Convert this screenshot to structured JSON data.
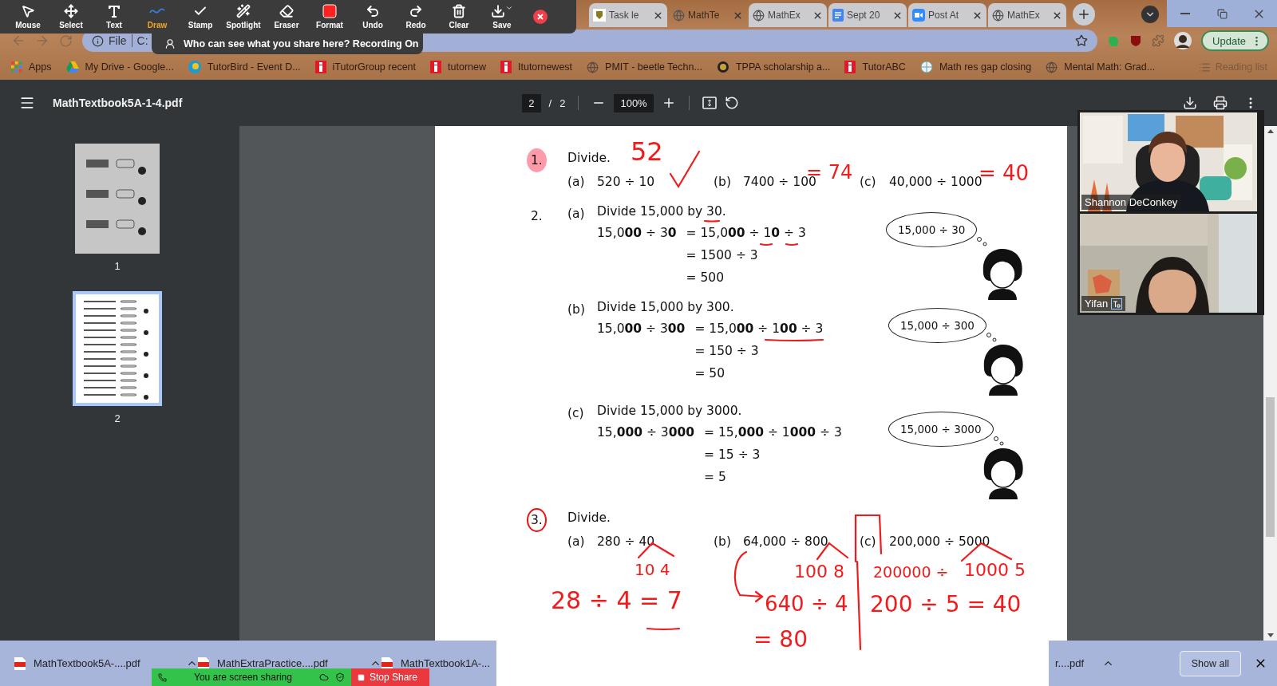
{
  "zoom_toolbar": {
    "tools": [
      {
        "label": "Mouse",
        "selected": false
      },
      {
        "label": "Select",
        "selected": false
      },
      {
        "label": "Text",
        "selected": false
      },
      {
        "label": "Draw",
        "selected": true
      },
      {
        "label": "Stamp",
        "selected": false
      },
      {
        "label": "Spotlight",
        "selected": false
      },
      {
        "label": "Eraser",
        "selected": false
      },
      {
        "label": "Format",
        "selected": false
      },
      {
        "label": "Undo",
        "selected": false
      },
      {
        "label": "Redo",
        "selected": false
      },
      {
        "label": "Clear",
        "selected": false
      },
      {
        "label": "Save",
        "selected": false
      }
    ],
    "banner": "Who can see what you share here? Recording On"
  },
  "tabs": [
    {
      "label": "Task le",
      "selected": false
    },
    {
      "label": "MathTe",
      "selected": true
    },
    {
      "label": "MathEx",
      "selected": false
    },
    {
      "label": "Sept 20",
      "selected": false
    },
    {
      "label": "Post At",
      "selected": false
    },
    {
      "label": "MathEx",
      "selected": false
    }
  ],
  "address_bar": {
    "scheme": "File",
    "url": "C:"
  },
  "update_button": "Update",
  "bookmarks": [
    {
      "label": "Apps"
    },
    {
      "label": "My Drive - Google..."
    },
    {
      "label": "TutorBird - Event D..."
    },
    {
      "label": "iTutorGroup recent"
    },
    {
      "label": "tutornew"
    },
    {
      "label": "Itutornewest"
    },
    {
      "label": "PMIT - beetle Techn..."
    },
    {
      "label": "TPPA scholarship a..."
    },
    {
      "label": "TutorABC"
    },
    {
      "label": "Math res gap closing"
    },
    {
      "label": "Mental Math: Grad..."
    }
  ],
  "reading_list": "Reading list",
  "pdf_toolbar": {
    "title": "MathTextbook5A-1-4.pdf",
    "page": "2",
    "separator": "/",
    "page_count": "2",
    "zoom": "100%"
  },
  "thumbnails": [
    {
      "label": "1",
      "selected": false
    },
    {
      "label": "2",
      "selected": true
    }
  ],
  "document": {
    "problem_1": {
      "number": "1.",
      "highlighted": true,
      "title": "Divide.",
      "parts": [
        {
          "label": "(a)",
          "expr": "520 ÷ 10"
        },
        {
          "label": "(b)",
          "expr": "7400 ÷ 100"
        },
        {
          "label": "(c)",
          "expr": "40,000 ÷ 1000"
        }
      ]
    },
    "problem_2": {
      "number": "2.",
      "parts": [
        {
          "label": "(a)",
          "title": "Divide 15,000 by 30.",
          "lhs": "15,0**00** ÷ 3**0**",
          "steps": [
            "= 15,0**00** ÷ 1**0** ÷ 3",
            "= 1500 ÷ 3",
            "= 500"
          ],
          "bubble": "15,000 ÷ 30"
        },
        {
          "label": "(b)",
          "title": "Divide 15,000 by 300.",
          "lhs": "15,0**00** ÷ 3**00**",
          "steps": [
            "= 15,0**00** ÷ 1**00** ÷ 3",
            "= 150 ÷ 3",
            "= 50"
          ],
          "bubble": "15,000 ÷ 300"
        },
        {
          "label": "(c)",
          "title": "Divide 15,000 by 3000.",
          "lhs": "15,**000** ÷ 3**000**",
          "steps": [
            "= 15,**000** ÷ 1**000** ÷ 3",
            "= 15 ÷ 3",
            "= 5"
          ],
          "bubble": "15,000 ÷ 3000"
        }
      ]
    },
    "problem_3": {
      "number": "3.",
      "circled": true,
      "title": "Divide.",
      "parts": [
        {
          "label": "(a)",
          "expr": "280 ÷ 40"
        },
        {
          "label": "(b)",
          "expr": "64,000 ÷ 800"
        },
        {
          "label": "(c)",
          "expr": "200,000 ÷ 5000"
        }
      ]
    }
  },
  "annotations": [
    {
      "kind": "text",
      "text": "52"
    },
    {
      "kind": "check"
    },
    {
      "kind": "text",
      "text": "= 74"
    },
    {
      "kind": "text",
      "text": "= 40"
    },
    {
      "kind": "underline"
    },
    {
      "kind": "underline"
    },
    {
      "kind": "underline"
    },
    {
      "kind": "underline"
    },
    {
      "kind": "split"
    },
    {
      "kind": "text",
      "text": "10 4"
    },
    {
      "kind": "text",
      "text": "28 ÷ 4 = 7"
    },
    {
      "kind": "underline"
    },
    {
      "kind": "arrow"
    },
    {
      "kind": "split"
    },
    {
      "kind": "text",
      "text": "100 8"
    },
    {
      "kind": "text",
      "text": "640 ÷ 4"
    },
    {
      "kind": "text",
      "text": "= 80"
    },
    {
      "kind": "bracket"
    },
    {
      "kind": "text",
      "text": "200000 ÷"
    },
    {
      "kind": "split"
    },
    {
      "kind": "text",
      "text": "1000 5"
    },
    {
      "kind": "text",
      "text": "200 ÷ 5 = 40"
    }
  ],
  "participants": [
    {
      "name": "Shannon DeConkey",
      "captions": false
    },
    {
      "name": "Yifan",
      "captions": true
    }
  ],
  "downloads": [
    {
      "name": "MathTextbook5A-....pdf"
    },
    {
      "name": "MathExtraPractice....pdf"
    },
    {
      "name": "MathTextbook1A-..."
    },
    {
      "name": "r....pdf"
    }
  ],
  "show_all": "Show all",
  "share_bar": {
    "status": "You are screen sharing",
    "stop": "Stop Share"
  }
}
